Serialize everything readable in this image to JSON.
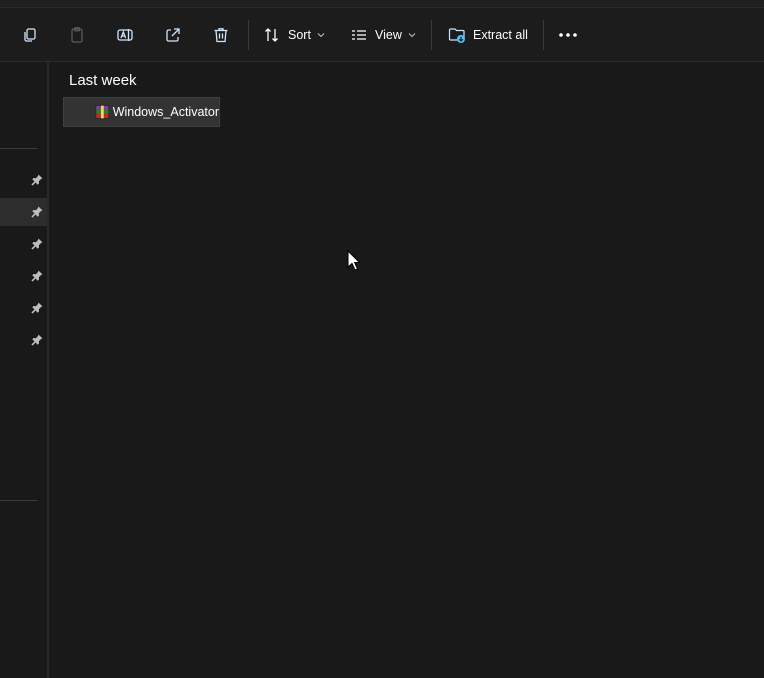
{
  "toolbar": {
    "sort_label": "Sort",
    "view_label": "View",
    "extract_all_label": "Extract all"
  },
  "sidebar": {
    "pinned_items_count_visible": 6,
    "selected_index": 1
  },
  "content": {
    "group_header": "Last week",
    "files": [
      {
        "name": "Windows_Activator",
        "icon": "winrar-archive-icon"
      }
    ]
  },
  "colors": {
    "background": "#191919",
    "toolbar": "#1c1c1c",
    "selection": "#333333",
    "accent": "#4cc2ff"
  }
}
